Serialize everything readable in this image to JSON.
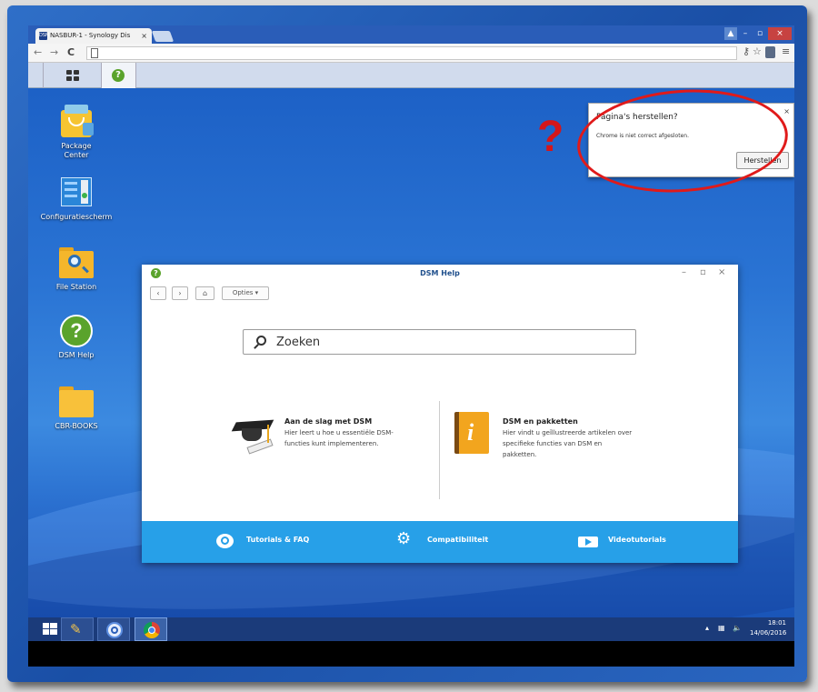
{
  "browser": {
    "tab_title": "NASBUR-1 - Synology Dis",
    "tab_favicon_text": "DSM",
    "tab_close": "×",
    "window_controls": {
      "minimize": "–",
      "maximize": "▫",
      "close": "×"
    },
    "nav": {
      "back": "←",
      "forward": "→",
      "reload": "C"
    }
  },
  "restore_popup": {
    "title": "Pagina's herstellen?",
    "message": "Chrome is niet correct afgesloten.",
    "button": "Herstellen",
    "close": "×",
    "annotation": "?"
  },
  "desktop_icons": [
    {
      "label": "Package Center",
      "icon": "package-center-icon"
    },
    {
      "label": "Configuratiescherm",
      "icon": "control-panel-icon"
    },
    {
      "label": "File Station",
      "icon": "file-station-icon"
    },
    {
      "label": "DSM Help",
      "icon": "dsm-help-icon"
    },
    {
      "label": "CBR-BOOKS",
      "icon": "folder-icon"
    }
  ],
  "help_window": {
    "title": "DSM Help",
    "options_label": "Opties ▾",
    "search_placeholder": "Zoeken",
    "topics": [
      {
        "title": "Aan de slag met DSM",
        "desc1": "Hier leert u hoe u essentiële DSM-",
        "desc2": "functies kunt implementeren."
      },
      {
        "title": "DSM en pakketten",
        "desc1": "Hier vindt u geïllustreerde artikelen over",
        "desc2": "specifieke functies van DSM en",
        "desc3": "pakketten."
      }
    ],
    "footer": {
      "tutorials": "Tutorials & FAQ",
      "compat": "Compatibiliteit",
      "video": "Videotutorials"
    }
  },
  "taskbar": {
    "time": "18:01",
    "date": "14/06/2016"
  },
  "colors": {
    "desktop_blue": "#2a74d4",
    "help_footer": "#27a0e8",
    "annotation_red": "#e01a1a"
  }
}
